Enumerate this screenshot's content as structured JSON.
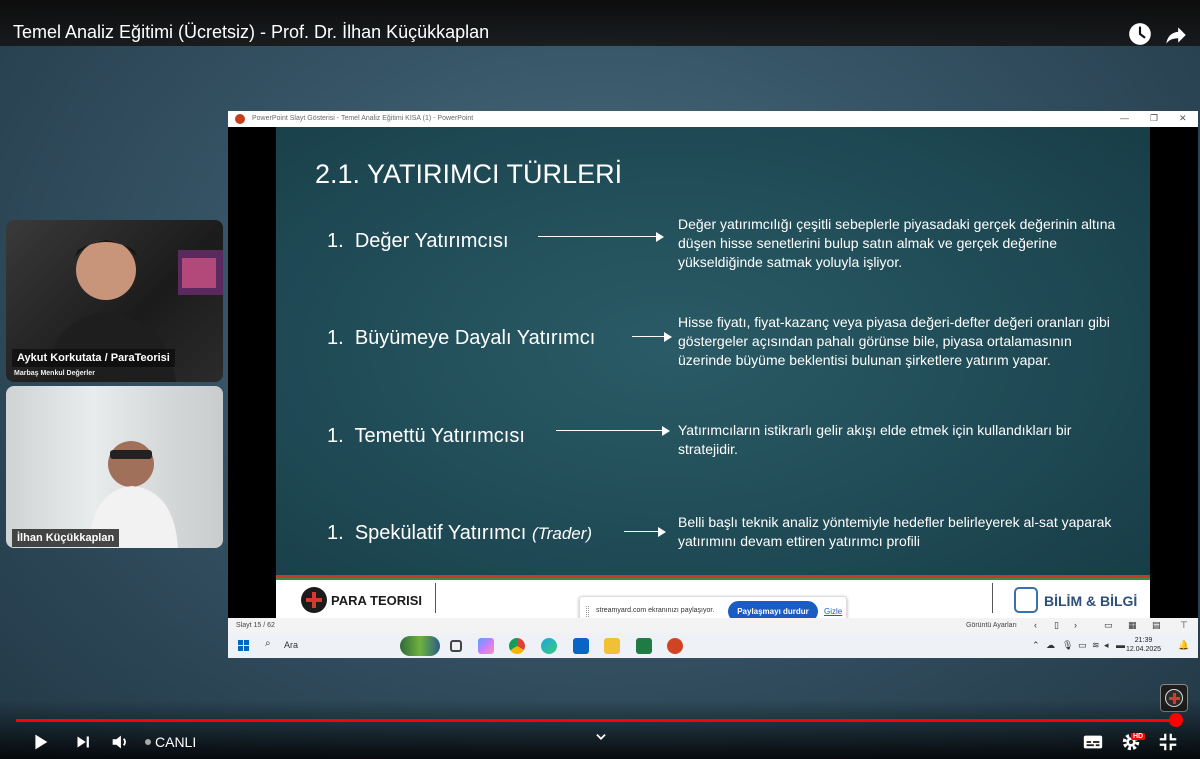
{
  "player": {
    "title": "Temel Analiz Eğitimi (Ücretsiz) - Prof. Dr. İlhan Küçükkaplan",
    "live_label": "CANLI",
    "hd_label": "HD",
    "progress_fraction": 0.995
  },
  "participants": [
    {
      "name": "Aykut Korkutata / ParaTeorisi",
      "subtitle": "Marbaş Menkul Değerler"
    },
    {
      "name": "İlhan Küçükkaplan"
    }
  ],
  "powerpoint": {
    "window_title": "PowerPoint Slayt Gösterisi  -  Temel Analiz Eğitimi KISA (1) - PowerPoint",
    "slide_counter": "Slayt 15 / 62",
    "view_settings": "Görüntü Ayarları"
  },
  "slide": {
    "title": "2.1. YATIRIMCI TÜRLERİ",
    "rows": [
      {
        "number": "1.",
        "label": "Değer Yatırımcısı",
        "label_suffix": "",
        "description": "Değer yatırımcılığı çeşitli sebeplerle piyasadaki gerçek değerinin altına düşen hisse senetlerini bulup satın almak ve gerçek değerine yükseldiğinde satmak yoluyla işliyor."
      },
      {
        "number": "1.",
        "label": "Büyümeye Dayalı Yatırımcı",
        "label_suffix": "",
        "description": "Hisse fiyatı, fiyat-kazanç veya piyasa değeri-defter değeri oranları gibi göstergeler açısından pahalı görünse bile, piyasa ortalamasının üzerinde büyüme beklentisi bulunan şirketlere yatırım yapar."
      },
      {
        "number": "1.",
        "label": "Temettü Yatırımcısı",
        "label_suffix": "",
        "description": "Yatırımcıların istikrarlı gelir akışı elde etmek için kullandıkları bir stratejidir."
      },
      {
        "number": "1.",
        "label": "Spekülatif Yatırımcı",
        "label_suffix": "(Trader)",
        "description": "Belli başlı teknik analiz yöntemiyle hedefler belirleyerek al-sat yaparak yatırımını devam ettiren yatırımcı profili"
      }
    ],
    "footer_left_brand": "PARA TEORISI",
    "footer_right_brand": "BİLİM & BİLGİ"
  },
  "share_banner": {
    "message": "streamyard.com ekranınızı paylaşıyor.",
    "stop_button": "Paylaşmayı durdur",
    "hide_link": "Gizle"
  },
  "taskbar": {
    "search_label": "Ara",
    "time": "21:39",
    "date": "12.04.2025"
  },
  "colors": {
    "accent_red": "#ff0000",
    "slide_bg": "#1f4a55",
    "share_blue": "#1a5bc4"
  },
  "icons": {
    "watch_later": "clock-icon",
    "share": "share-arrow-icon",
    "play": "play-icon",
    "next": "skip-next-icon",
    "volume": "volume-icon",
    "subtitles": "subtitles-icon",
    "settings": "gear-icon",
    "exit_fullscreen": "exit-fullscreen-icon"
  }
}
